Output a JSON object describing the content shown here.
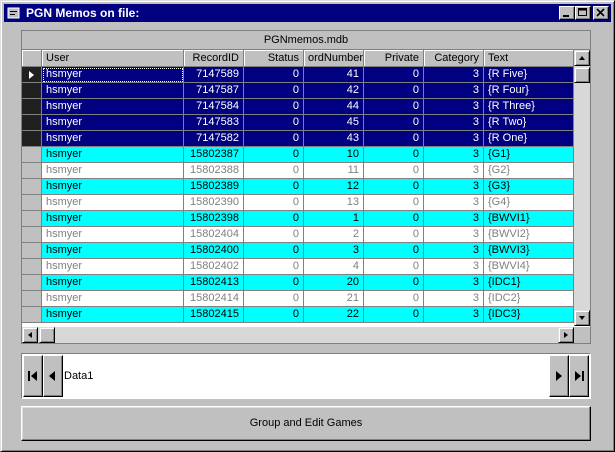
{
  "window": {
    "title": "PGN Memos on file:"
  },
  "grid": {
    "caption": "PGNmemos.mdb",
    "columns": [
      "User",
      "RecordID",
      "Status",
      "ordNumber",
      "Private",
      "Category",
      "Text"
    ],
    "rows": [
      {
        "user": "hsmyer",
        "record_id": "7147589",
        "status": "0",
        "ord": "41",
        "private": "0",
        "category": "3",
        "text": "{R Five}",
        "style": "navy",
        "current": true
      },
      {
        "user": "hsmyer",
        "record_id": "7147587",
        "status": "0",
        "ord": "42",
        "private": "0",
        "category": "3",
        "text": "{R Four}",
        "style": "navy"
      },
      {
        "user": "hsmyer",
        "record_id": "7147584",
        "status": "0",
        "ord": "44",
        "private": "0",
        "category": "3",
        "text": "{R Three}",
        "style": "navy"
      },
      {
        "user": "hsmyer",
        "record_id": "7147583",
        "status": "0",
        "ord": "45",
        "private": "0",
        "category": "3",
        "text": "{R Two}",
        "style": "navy"
      },
      {
        "user": "hsmyer",
        "record_id": "7147582",
        "status": "0",
        "ord": "43",
        "private": "0",
        "category": "3",
        "text": "{R One}",
        "style": "navy"
      },
      {
        "user": "hsmyer",
        "record_id": "15802387",
        "status": "0",
        "ord": "10",
        "private": "0",
        "category": "3",
        "text": "{G1}",
        "style": "cyan"
      },
      {
        "user": "hsmyer",
        "record_id": "15802388",
        "status": "0",
        "ord": "11",
        "private": "0",
        "category": "3",
        "text": "{G2}",
        "style": "white"
      },
      {
        "user": "hsmyer",
        "record_id": "15802389",
        "status": "0",
        "ord": "12",
        "private": "0",
        "category": "3",
        "text": "{G3}",
        "style": "cyan"
      },
      {
        "user": "hsmyer",
        "record_id": "15802390",
        "status": "0",
        "ord": "13",
        "private": "0",
        "category": "3",
        "text": "{G4}",
        "style": "white"
      },
      {
        "user": "hsmyer",
        "record_id": "15802398",
        "status": "0",
        "ord": "1",
        "private": "0",
        "category": "3",
        "text": "{BWVI1}",
        "style": "cyan"
      },
      {
        "user": "hsmyer",
        "record_id": "15802404",
        "status": "0",
        "ord": "2",
        "private": "0",
        "category": "3",
        "text": "{BWVI2}",
        "style": "white"
      },
      {
        "user": "hsmyer",
        "record_id": "15802400",
        "status": "0",
        "ord": "3",
        "private": "0",
        "category": "3",
        "text": "{BWVI3}",
        "style": "cyan"
      },
      {
        "user": "hsmyer",
        "record_id": "15802402",
        "status": "0",
        "ord": "4",
        "private": "0",
        "category": "3",
        "text": "{BWVI4}",
        "style": "white"
      },
      {
        "user": "hsmyer",
        "record_id": "15802413",
        "status": "0",
        "ord": "20",
        "private": "0",
        "category": "3",
        "text": "{IDC1}",
        "style": "cyan"
      },
      {
        "user": "hsmyer",
        "record_id": "15802414",
        "status": "0",
        "ord": "21",
        "private": "0",
        "category": "3",
        "text": "{IDC2}",
        "style": "white"
      },
      {
        "user": "hsmyer",
        "record_id": "15802415",
        "status": "0",
        "ord": "22",
        "private": "0",
        "category": "3",
        "text": "{IDC3}",
        "style": "cyan"
      }
    ]
  },
  "data_control": {
    "caption": "Data1"
  },
  "buttons": {
    "group_edit": "Group and Edit Games"
  },
  "colors": {
    "navy": "#000080",
    "cyan": "#00ffff",
    "white": "#ffffff",
    "gray_text": "#808080"
  }
}
